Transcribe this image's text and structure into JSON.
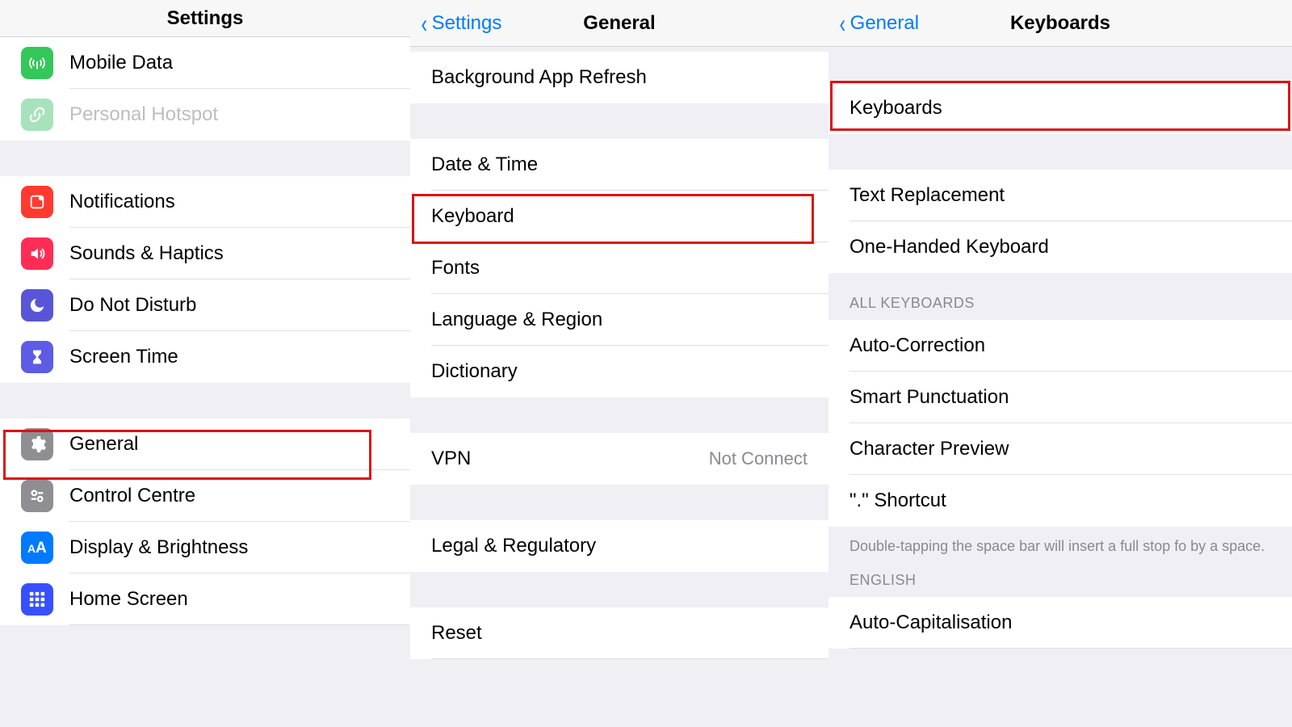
{
  "panel1": {
    "title": "Settings",
    "items_top": [
      {
        "id": "mobile-data",
        "icon": "mobile",
        "label": "Mobile Data"
      },
      {
        "id": "personal-hotspot",
        "icon": "hotspot",
        "label": "Personal Hotspot",
        "disabled": true
      }
    ],
    "items_mid": [
      {
        "id": "notifications",
        "icon": "notif",
        "label": "Notifications"
      },
      {
        "id": "sounds",
        "icon": "sound",
        "label": "Sounds & Haptics"
      },
      {
        "id": "dnd",
        "icon": "dnd",
        "label": "Do Not Disturb"
      },
      {
        "id": "screen-time",
        "icon": "screen",
        "label": "Screen Time"
      }
    ],
    "items_bottom": [
      {
        "id": "general",
        "icon": "general",
        "label": "General"
      },
      {
        "id": "control-centre",
        "icon": "control",
        "label": "Control Centre"
      },
      {
        "id": "display",
        "icon": "display",
        "label": "Display & Brightness"
      },
      {
        "id": "home-screen",
        "icon": "home",
        "label": "Home Screen"
      }
    ]
  },
  "panel2": {
    "back": "Settings",
    "title": "General",
    "group1": [
      "Background App Refresh"
    ],
    "group2": [
      "Date & Time",
      "Keyboard",
      "Fonts",
      "Language & Region",
      "Dictionary"
    ],
    "group3_label": "VPN",
    "group3_value": "Not Connect",
    "group4": [
      "Legal & Regulatory"
    ],
    "group5": [
      "Reset"
    ]
  },
  "panel3": {
    "back": "General",
    "title": "Keyboards",
    "group1": [
      "Keyboards"
    ],
    "group2": [
      "Text Replacement",
      "One-Handed Keyboard"
    ],
    "section_header": "ALL KEYBOARDS",
    "group3": [
      "Auto-Correction",
      "Smart Punctuation",
      "Character Preview",
      "\".\" Shortcut"
    ],
    "footer": "Double-tapping the space bar will insert a full stop fo by a space.",
    "section_header2": "ENGLISH",
    "group4": [
      "Auto-Capitalisation"
    ]
  }
}
